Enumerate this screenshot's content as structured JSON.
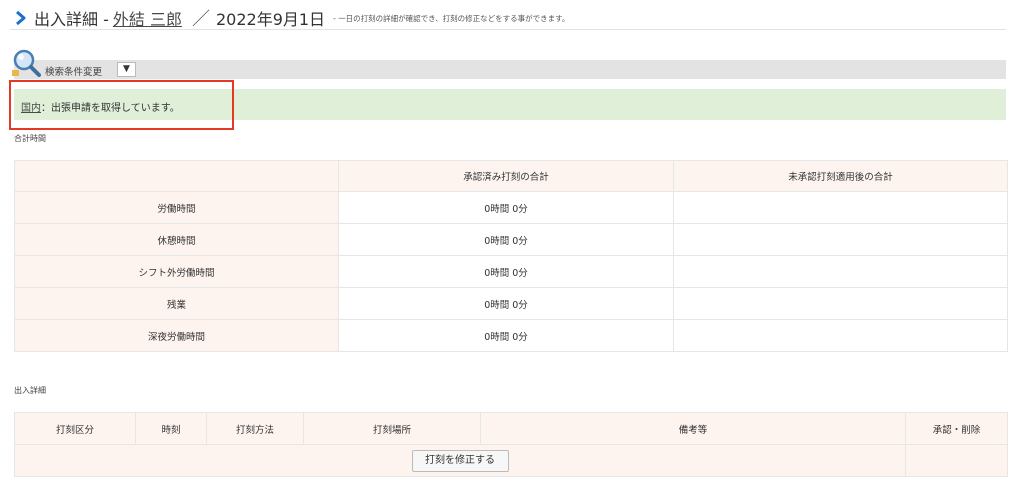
{
  "header": {
    "title": "出入詳細 -",
    "user_name": "外結 三郎",
    "separator": "／",
    "date": "2022年9月1日",
    "description": "- 一日の打刻の詳細が確認でき、打刻の修正などをする事ができます。"
  },
  "search": {
    "label": "検索条件変更",
    "toggle": "▼"
  },
  "notice": {
    "link": "国内",
    "text": "：出張申請を取得しています。"
  },
  "summary": {
    "section_title": "合計時間",
    "headers": [
      "",
      "承認済み打刻の合計",
      "未承認打刻適用後の合計"
    ],
    "rows": [
      {
        "label": "労働時間",
        "approved": "0時間 0分",
        "unapproved": ""
      },
      {
        "label": "休憩時間",
        "approved": "0時間 0分",
        "unapproved": ""
      },
      {
        "label": "シフト外労働時間",
        "approved": "0時間 0分",
        "unapproved": ""
      },
      {
        "label": "残業",
        "approved": "0時間 0分",
        "unapproved": ""
      },
      {
        "label": "深夜労働時間",
        "approved": "0時間 0分",
        "unapproved": ""
      }
    ]
  },
  "details": {
    "section_title": "出入詳細",
    "headers": [
      "打刻区分",
      "時刻",
      "打刻方法",
      "打刻場所",
      "備考等",
      "承認・削除"
    ],
    "fix_button": "打刻を修正する"
  },
  "colors": {
    "accent": "#1a6fd1",
    "notice_bg": "#dfefd8",
    "highlight": "#e23a25",
    "table_header_bg": "#fdf3ef"
  }
}
